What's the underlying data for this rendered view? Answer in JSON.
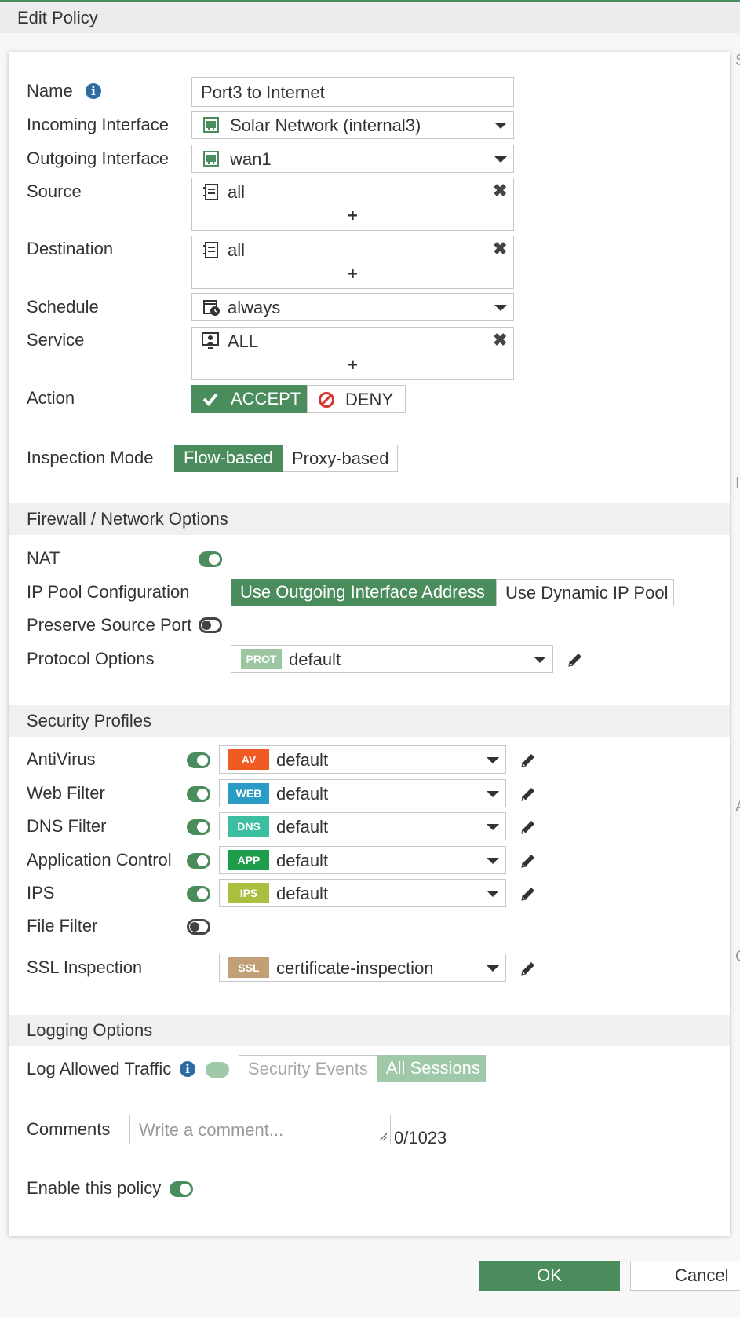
{
  "window": {
    "title": "Edit Policy"
  },
  "side_letters": [
    "S",
    "I",
    "A",
    "C"
  ],
  "form": {
    "name": {
      "label": "Name",
      "value": "Port3 to Internet"
    },
    "incoming": {
      "label": "Incoming Interface",
      "value": "Solar Network (internal3)"
    },
    "outgoing": {
      "label": "Outgoing Interface",
      "value": "wan1"
    },
    "source": {
      "label": "Source",
      "value": "all",
      "add": "+",
      "remove": "✖"
    },
    "destination": {
      "label": "Destination",
      "value": "all",
      "add": "+",
      "remove": "✖"
    },
    "schedule": {
      "label": "Schedule",
      "value": "always"
    },
    "service": {
      "label": "Service",
      "value": "ALL",
      "add": "+",
      "remove": "✖"
    },
    "action": {
      "label": "Action",
      "accept": "ACCEPT",
      "deny": "DENY",
      "selected": "ACCEPT"
    },
    "inspection": {
      "label": "Inspection Mode",
      "flow": "Flow-based",
      "proxy": "Proxy-based",
      "selected": "Flow-based"
    }
  },
  "firewall": {
    "title": "Firewall / Network Options",
    "nat": {
      "label": "NAT",
      "on": true
    },
    "ip_pool": {
      "label": "IP Pool Configuration",
      "outgoing": "Use Outgoing Interface Address",
      "dynamic": "Use Dynamic IP Pool",
      "selected": "Use Outgoing Interface Address"
    },
    "preserve": {
      "label": "Preserve Source Port",
      "on": false
    },
    "protocol": {
      "label": "Protocol Options",
      "badge": "PROT",
      "value": "default"
    }
  },
  "security": {
    "title": "Security Profiles",
    "profiles": [
      {
        "label": "AntiVirus",
        "badge": "AV",
        "color": "#f15a22",
        "value": "default",
        "on": true
      },
      {
        "label": "Web Filter",
        "badge": "WEB",
        "color": "#2a9bc4",
        "value": "default",
        "on": true
      },
      {
        "label": "DNS Filter",
        "badge": "DNS",
        "color": "#3bbfa0",
        "value": "default",
        "on": true
      },
      {
        "label": "Application Control",
        "badge": "APP",
        "color": "#1e9e4a",
        "value": "default",
        "on": true
      },
      {
        "label": "IPS",
        "badge": "IPS",
        "color": "#a9c03e",
        "value": "default",
        "on": true
      }
    ],
    "file_filter": {
      "label": "File Filter",
      "on": false
    },
    "ssl": {
      "label": "SSL Inspection",
      "badge": "SSL",
      "color": "#c1a078",
      "value": "certificate-inspection"
    }
  },
  "logging": {
    "title": "Logging Options",
    "allowed": {
      "label": "Log Allowed Traffic",
      "security": "Security Events",
      "all": "All Sessions",
      "selected": "All Sessions"
    }
  },
  "comments": {
    "label": "Comments",
    "placeholder": "Write a comment...",
    "count": "0/1023"
  },
  "enable": {
    "label": "Enable this policy",
    "on": true
  },
  "footer": {
    "ok": "OK",
    "cancel": "Cancel"
  },
  "colors": {
    "accent": "#4a8c5c",
    "deny": "#d9342b",
    "info": "#2b6ca3"
  }
}
